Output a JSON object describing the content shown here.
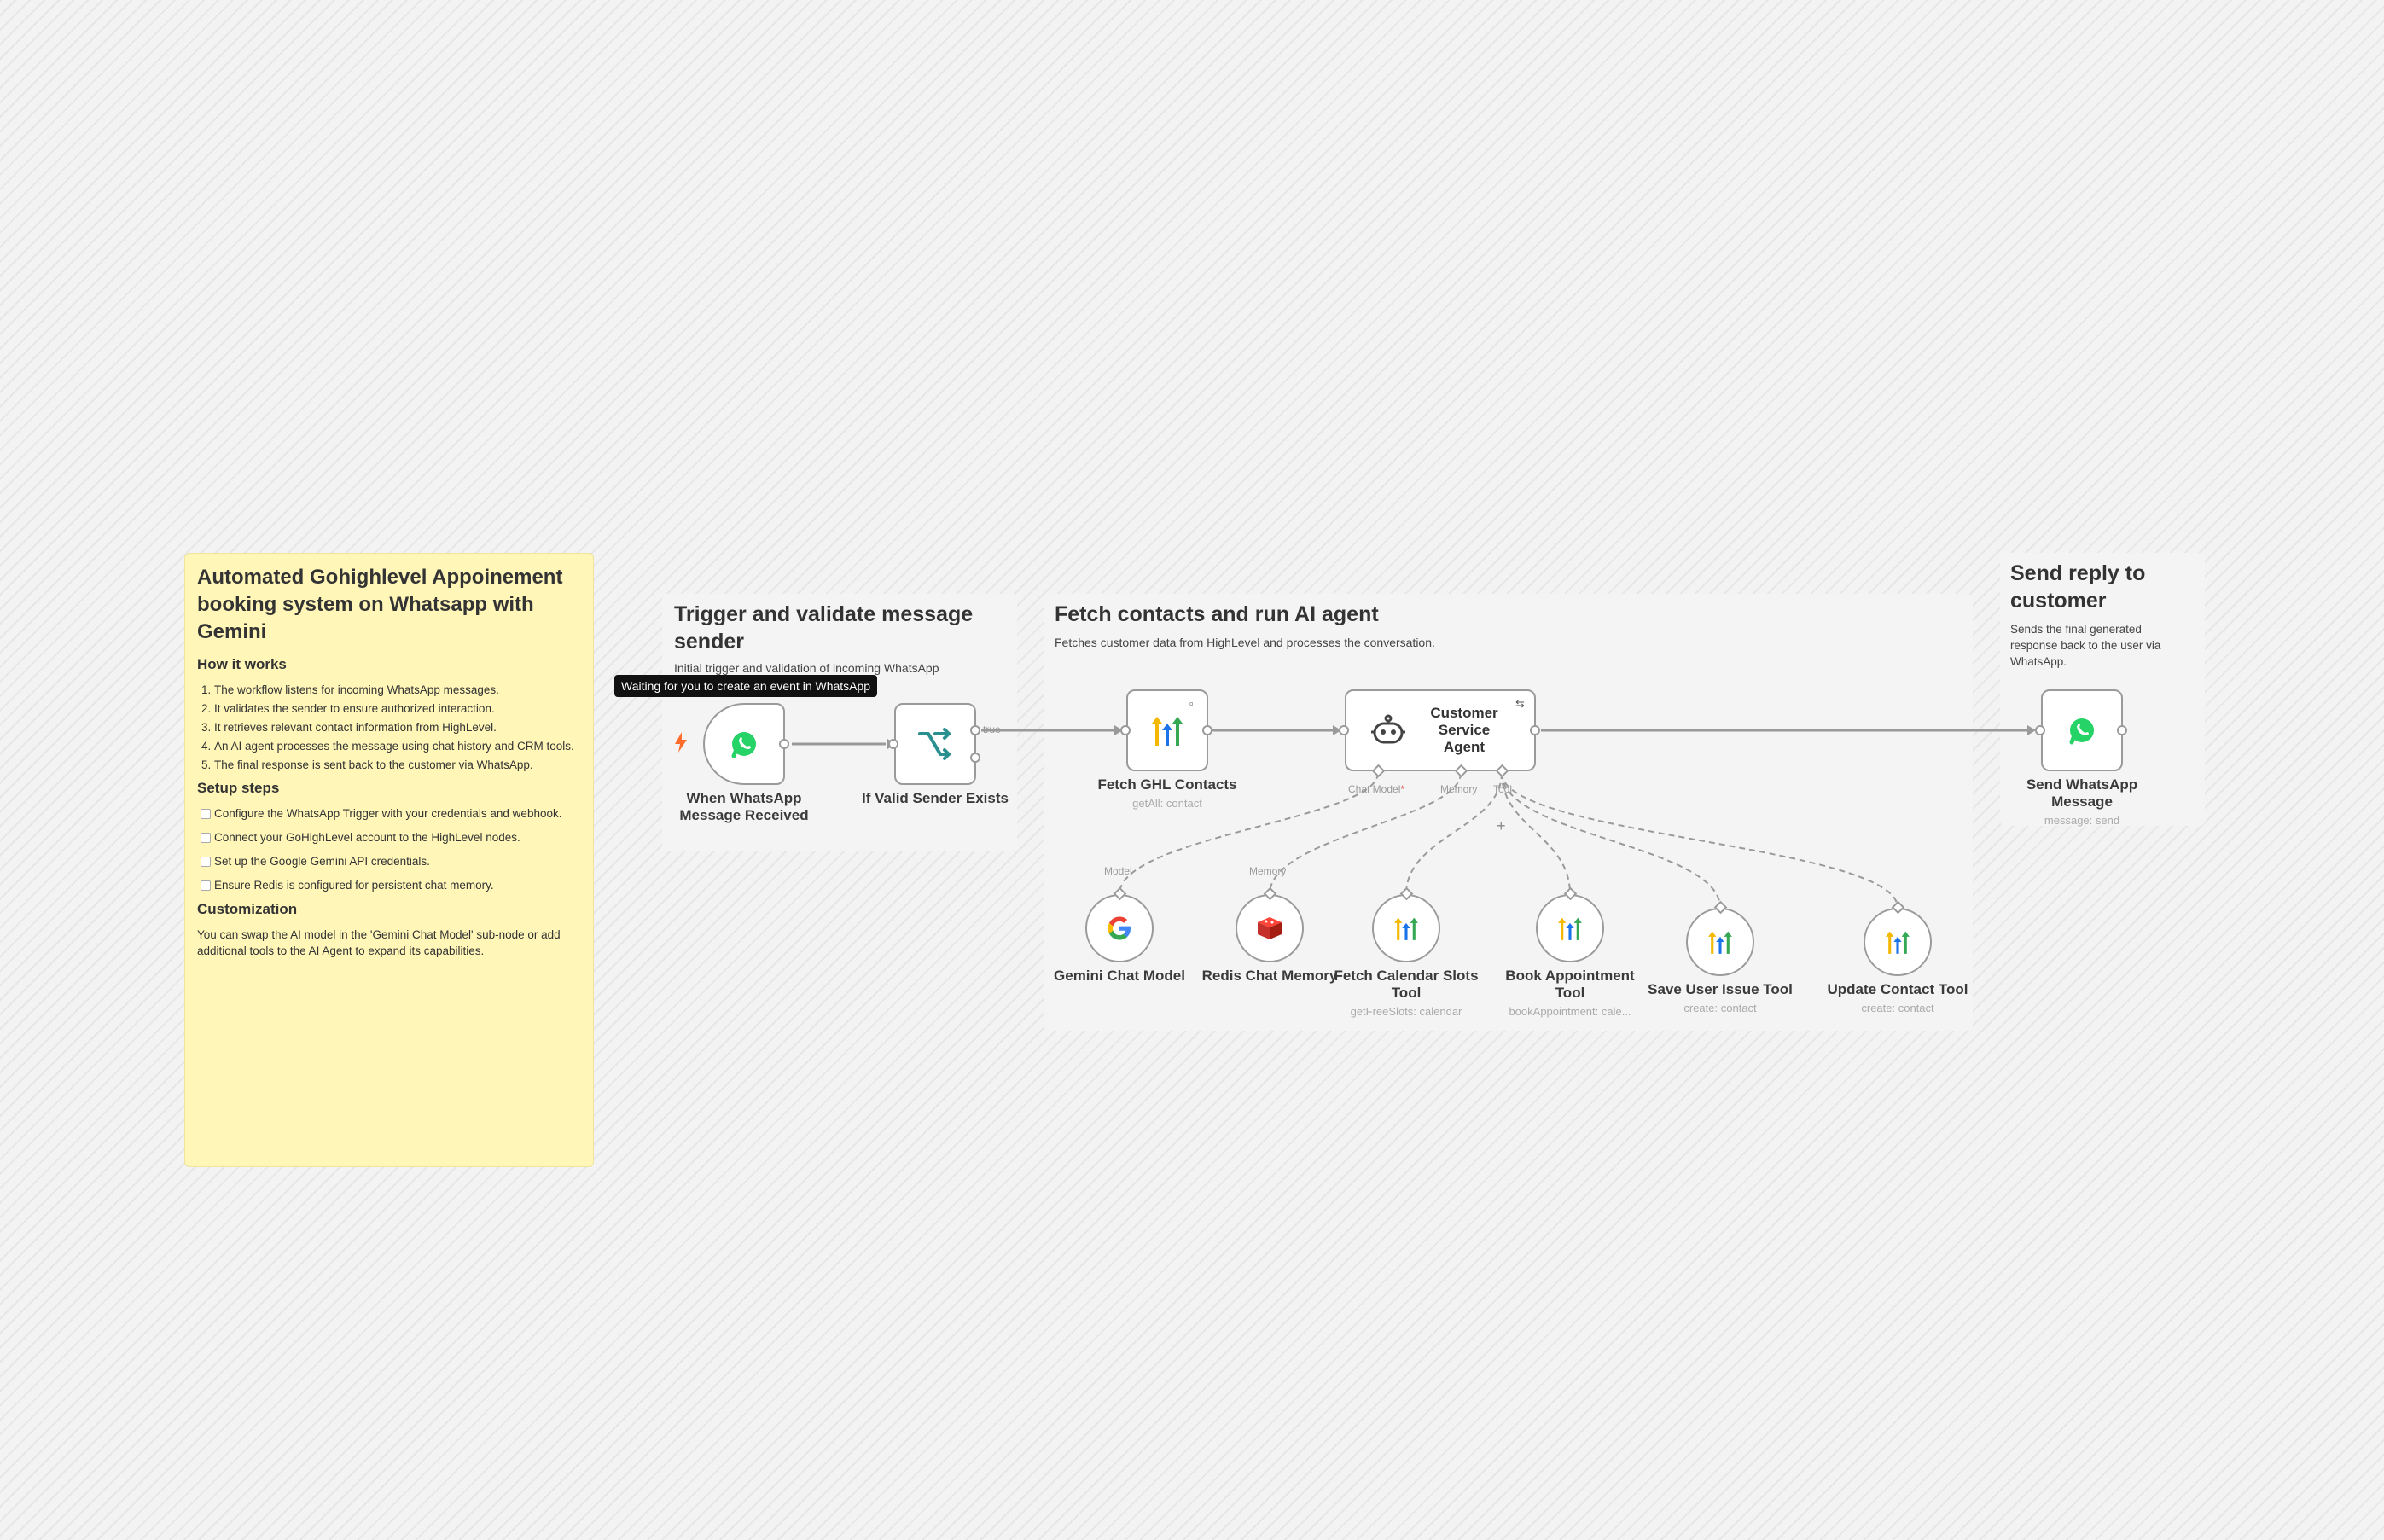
{
  "colors": {
    "sticky_yellow": "#fff6b8",
    "whatsapp_green": "#25d366",
    "switch_teal": "#2a8f8f",
    "redis_red": "#d82c20",
    "trigger_orange": "#ff6d2d"
  },
  "main_note": {
    "title": "Automated Gohighlevel Appoinement booking system on Whatsapp with Gemini",
    "how_heading": "How it works",
    "how_steps": [
      "The workflow listens for incoming WhatsApp messages.",
      "It validates the sender to ensure authorized interaction.",
      "It retrieves relevant contact information from HighLevel.",
      "An AI agent processes the message using chat history and CRM tools.",
      "The final response is sent back to the customer via WhatsApp."
    ],
    "setup_heading": "Setup steps",
    "setup_steps": [
      "Configure the WhatsApp Trigger with your credentials and webhook.",
      "Connect your GoHighLevel account to the HighLevel nodes.",
      "Set up the Google Gemini API credentials.",
      "Ensure Redis is configured for persistent chat memory."
    ],
    "custom_heading": "Customization",
    "custom_text": "You can swap the AI model in the 'Gemini Chat Model' sub-node or add additional tools to the AI Agent to expand its capabilities."
  },
  "groups": {
    "trigger": {
      "title": "Trigger and validate message sender",
      "subtitle": "Initial trigger and validation of incoming WhatsApp"
    },
    "agent": {
      "title": "Fetch contacts and run AI agent",
      "subtitle": "Fetches customer data from HighLevel and processes the conversation."
    },
    "reply": {
      "title": "Send reply to customer",
      "subtitle": "Sends the final generated response back to the user via WhatsApp."
    }
  },
  "tooltip": "Waiting for you to create an event in WhatsApp",
  "nodes": {
    "whatsapp_trigger": {
      "label": "When WhatsApp Message Received",
      "icon": "whatsapp-icon"
    },
    "if_valid": {
      "label": "If Valid Sender Exists",
      "icon": "branch-icon",
      "true_label": "true"
    },
    "fetch_ghl": {
      "label": "Fetch GHL Contacts",
      "sub": "getAll: contact",
      "icon": "highlevel-icon"
    },
    "agent": {
      "label": "Customer Service Agent",
      "icon": "robot-icon",
      "port_chat_model": "Chat Model",
      "required_mark": "*",
      "port_memory": "Memory",
      "port_tool": "Tool",
      "plus": "+"
    },
    "send_whatsapp": {
      "label": "Send WhatsApp Message",
      "sub": "message: send",
      "icon": "whatsapp-icon"
    },
    "gemini": {
      "label": "Gemini Chat Model",
      "top": "Model",
      "icon": "google-icon"
    },
    "redis": {
      "label": "Redis Chat Memory",
      "top": "Memory",
      "icon": "redis-icon"
    },
    "fetch_slots": {
      "label": "Fetch Calendar Slots Tool",
      "sub": "getFreeSlots: calendar",
      "icon": "highlevel-icon"
    },
    "book": {
      "label": "Book Appointment Tool",
      "sub": "bookAppointment: cale...",
      "icon": "highlevel-icon"
    },
    "save_issue": {
      "label": "Save User Issue Tool",
      "sub": "create: contact",
      "icon": "highlevel-icon"
    },
    "update_contact": {
      "label": "Update Contact Tool",
      "sub": "create: contact",
      "icon": "highlevel-icon"
    }
  }
}
